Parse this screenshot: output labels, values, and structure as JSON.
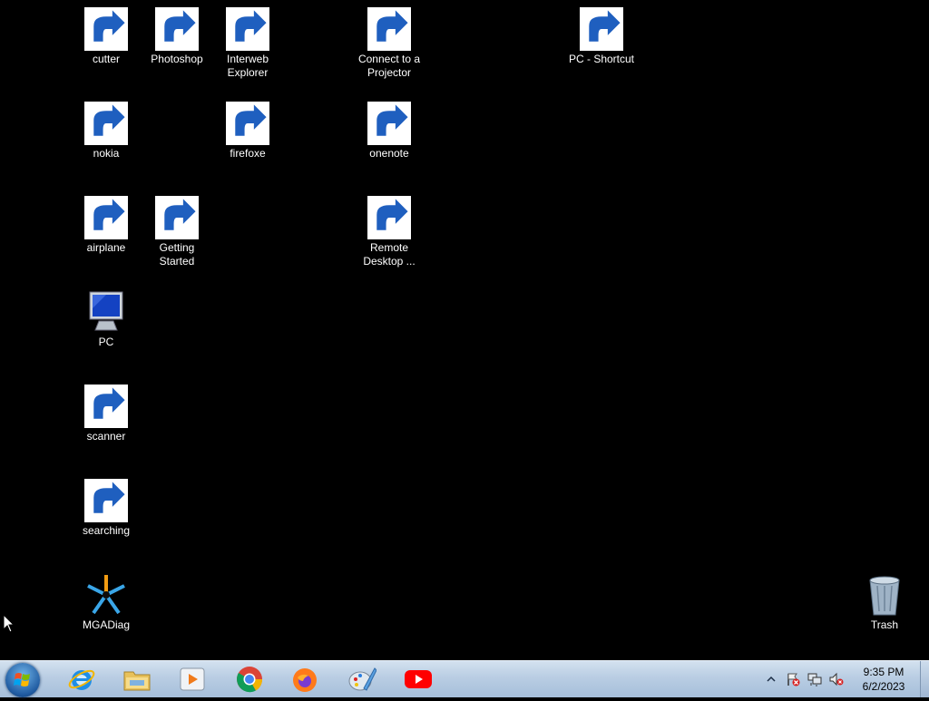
{
  "desktop": {
    "icons": [
      {
        "label": "cutter"
      },
      {
        "label": "Photoshop"
      },
      {
        "label": "Interweb\nExplorer"
      },
      {
        "label": "Connect to a\nProjector"
      },
      {
        "label": "PC - Shortcut"
      },
      {
        "label": "nokia"
      },
      {
        "label": "firefoxe"
      },
      {
        "label": "onenote"
      },
      {
        "label": "airplane"
      },
      {
        "label": "Getting\nStarted"
      },
      {
        "label": "Remote\nDesktop ..."
      },
      {
        "label": "PC"
      },
      {
        "label": "scanner"
      },
      {
        "label": "searching"
      },
      {
        "label": "MGADiag"
      },
      {
        "label": "Trash"
      }
    ]
  },
  "taskbar": {
    "pinned": [
      "internet-explorer-icon",
      "file-explorer-icon",
      "media-player-icon",
      "chrome-icon",
      "firefox-icon",
      "paint-icon",
      "youtube-icon"
    ],
    "clock": {
      "time": "9:35 PM",
      "date": "6/2/2023"
    }
  }
}
